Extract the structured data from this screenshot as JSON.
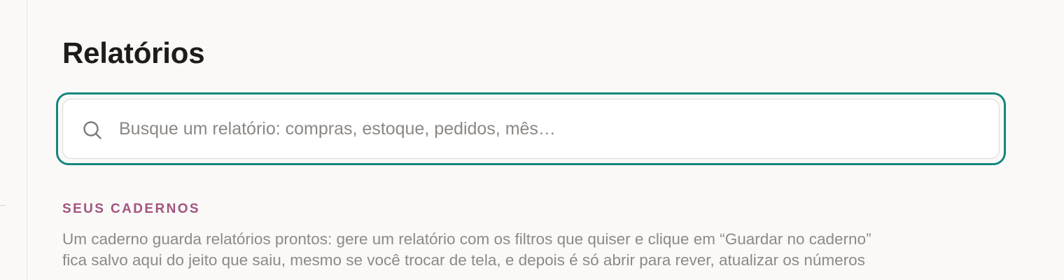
{
  "page": {
    "title": "Relatórios"
  },
  "search": {
    "placeholder": "Busque um relatório: compras, estoque, pedidos, mês…",
    "value": "",
    "icon": "search-icon"
  },
  "notebooks": {
    "heading": "SEUS CADERNOS",
    "description_line_1": "Um caderno guarda relatórios prontos: gere um relatório com os filtros que quiser e clique em “Guardar no caderno”",
    "description_line_2": "fica salvo aqui do jeito que saiu, mesmo se você trocar de tela, e depois é só abrir para rever, atualizar os números"
  },
  "colors": {
    "accent": "#14877e",
    "section_heading": "#a1547f",
    "title": "#1e1c1b",
    "muted_text": "#8d8986",
    "background": "#faf9f8"
  }
}
